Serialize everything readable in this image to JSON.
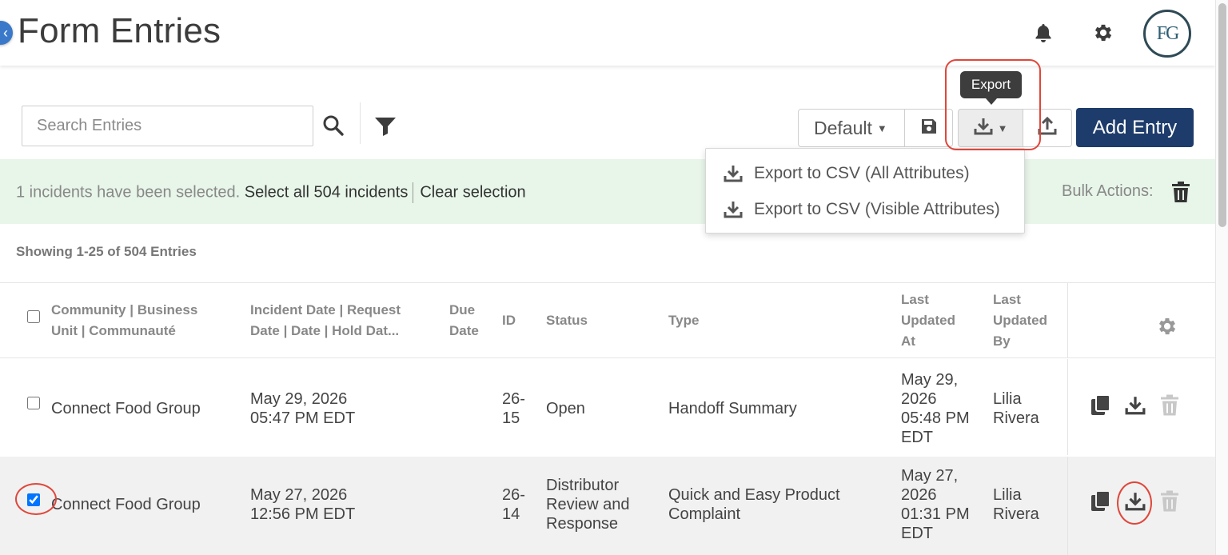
{
  "header": {
    "title": "Form Entries",
    "back_icon": "chevron-left-icon",
    "avatar_initials": "FG"
  },
  "toolbar": {
    "search_placeholder": "Search Entries",
    "view_select": "Default",
    "export_tooltip": "Export",
    "add_entry_label": "Add Entry"
  },
  "export_menu": {
    "items": [
      {
        "label": "Export to CSV (All Attributes)",
        "icon": "download-icon"
      },
      {
        "label": "Export to CSV (Visible Attributes)",
        "icon": "download-icon"
      }
    ]
  },
  "selection_banner": {
    "message": "1 incidents have been selected.",
    "select_all": "Select all 504 incidents",
    "clear": "Clear selection",
    "bulk_actions": "Bulk Actions:"
  },
  "listing": {
    "showing": "Showing 1-25 of 504 Entries"
  },
  "table": {
    "columns": [
      "Community | Business Unit | Communauté",
      "Incident Date | Request Date | Date | Hold Dat...",
      "Due Date",
      "ID",
      "Status",
      "Type",
      "Last Updated At",
      "Last Updated By"
    ],
    "header_lines": {
      "community": [
        "Community | Business",
        "Unit | Communauté"
      ],
      "incident": [
        "Incident Date | Request",
        "Date | Date | Hold Dat..."
      ],
      "due": [
        "Due",
        "Date"
      ],
      "updated_at": [
        "Last",
        "Updated",
        "At"
      ],
      "updated_by": [
        "Last",
        "Updated",
        "By"
      ]
    },
    "rows": [
      {
        "checked": false,
        "community": "Connect Food Group",
        "incident_date": [
          "May 29, 2026",
          "05:47 PM EDT"
        ],
        "due_date": "",
        "id": [
          "26-",
          "15"
        ],
        "status": [
          "Open"
        ],
        "type": [
          "Handoff Summary"
        ],
        "updated_at": [
          "May 29,",
          "2026",
          "05:48 PM",
          "EDT"
        ],
        "updated_by": [
          "Lilia",
          "Rivera"
        ]
      },
      {
        "checked": true,
        "community": "Connect Food Group",
        "incident_date": [
          "May 27, 2026",
          "12:56 PM EDT"
        ],
        "due_date": "",
        "id": [
          "26-",
          "14"
        ],
        "status": [
          "Distributor",
          "Review and",
          "Response"
        ],
        "type": [
          "Quick and Easy Product",
          "Complaint"
        ],
        "updated_at": [
          "May 27,",
          "2026",
          "01:31 PM",
          "EDT"
        ],
        "updated_by": [
          "Lilia",
          "Rivera"
        ]
      }
    ]
  },
  "colors": {
    "accent": "#1d3c6b",
    "banner": "#e8f5e9",
    "annotation": "#e0463a",
    "tooltip": "#3d3d3d"
  }
}
